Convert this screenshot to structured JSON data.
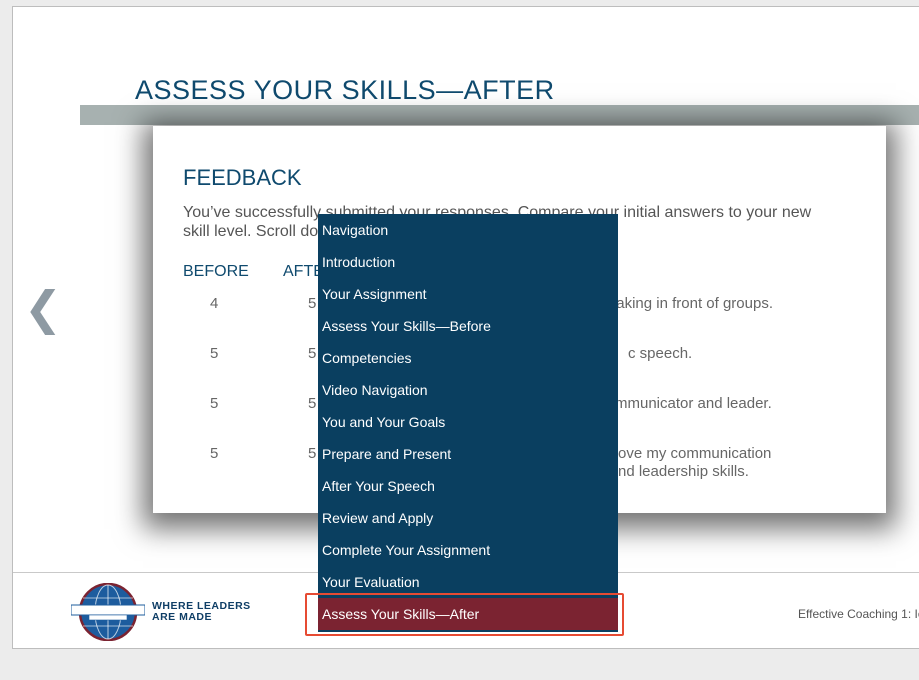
{
  "slide": {
    "title": "ASSESS YOUR SKILLS—AFTER",
    "prev_arrow": "❮"
  },
  "feedback": {
    "heading": "FEEDBACK",
    "intro_visible_start": "You’ve successfully",
    "intro_visible_mid": "submitted your responses. Compare your",
    "intro_visible_end": "initial answers to your new",
    "intro_line2": "skill level. Scroll do",
    "col_before": "BEFORE",
    "col_after": "AFTE",
    "rows": [
      {
        "before": "4",
        "after": "5",
        "line1": "aking in front of groups.",
        "line2": ""
      },
      {
        "before": "5",
        "after": "5",
        "line1": "c speech.",
        "line2": ""
      },
      {
        "before": "5",
        "after": "5",
        "line1": "mmunicator and leader.",
        "line2": ""
      },
      {
        "before": "5",
        "after": "5",
        "line1": "ove my communication",
        "line2": "nd leadership skills."
      }
    ]
  },
  "menu": {
    "items": [
      {
        "label": "Navigation"
      },
      {
        "label": "Introduction"
      },
      {
        "label": "Your Assignment"
      },
      {
        "label": "Assess Your Skills—Before"
      },
      {
        "label": "Competencies"
      },
      {
        "label": "Video Navigation"
      },
      {
        "label": "You and Your Goals"
      },
      {
        "label": "Prepare and Present"
      },
      {
        "label": "After Your Speech"
      },
      {
        "label": "Review and Apply"
      },
      {
        "label": "Complete Your Assignment"
      },
      {
        "label": "Your Evaluation"
      },
      {
        "label": "Assess Your Skills—After",
        "active": true
      }
    ]
  },
  "footer": {
    "logo_text": "TOASTMASTERS",
    "logo_subtext": "INTERNATIONAL",
    "tagline_line1": "WHERE LEADERS",
    "tagline_line2": "ARE MADE",
    "course_name": "Effective Coaching 1: Io"
  },
  "colors": {
    "title_blue": "#0f4a6e",
    "menu_bg": "#0a3f60",
    "menu_active": "#7b2331",
    "highlight": "#e64b33"
  }
}
